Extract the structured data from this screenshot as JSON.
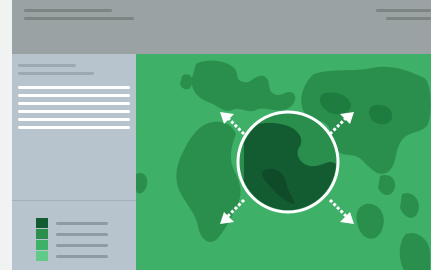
{
  "colors": {
    "page_bg": "#f1f2f2",
    "topbar_bg": "#9aa2a3",
    "topbar_lines": "#7d8584",
    "sidebar_bg": "#b7c3cd",
    "sidebar_text_lines": "#ffffff",
    "map_ocean": "#3fb067",
    "map_land": "#2a8f4d",
    "globe_land": "#135b31",
    "arrows": "#ffffff"
  },
  "legend": {
    "swatches": [
      "#135b31",
      "#2a8f4d",
      "#3fb067",
      "#5fcb86"
    ]
  },
  "map": {
    "icons": [
      "globe-icon",
      "expand-arrows-icon"
    ]
  }
}
